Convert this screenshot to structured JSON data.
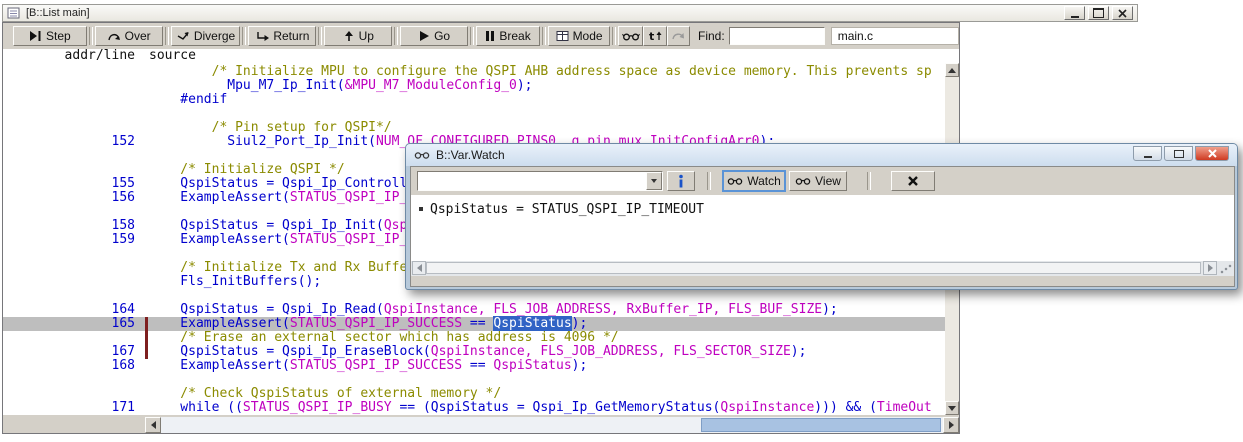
{
  "main_window": {
    "title": "[B::List main]",
    "toolbar": {
      "buttons": [
        {
          "id": "step",
          "label": "Step"
        },
        {
          "id": "over",
          "label": "Over"
        },
        {
          "id": "diverge",
          "label": "Diverge"
        },
        {
          "id": "return",
          "label": "Return"
        },
        {
          "id": "up",
          "label": "Up"
        },
        {
          "id": "go",
          "label": "Go"
        },
        {
          "id": "break",
          "label": "Break"
        },
        {
          "id": "mode",
          "label": "Mode"
        }
      ],
      "small_buttons": [
        {
          "id": "watch-glasses"
        },
        {
          "id": "t-up",
          "label": "t"
        },
        {
          "id": "redo-disabled"
        }
      ],
      "find_label": "Find:",
      "find_value": "",
      "file_field": "main.c"
    },
    "listing": {
      "header_addr": "addr/line",
      "header_source": "source",
      "rows": [
        {
          "num": "",
          "segments": [
            {
              "t": "        /* Initialize MPU to configure the QSPI AHB address space as device memory. This prevents sp",
              "c": "comment"
            }
          ]
        },
        {
          "num": "",
          "segments": [
            {
              "t": "          Mpu_M7_Ip_Init(",
              "c": "code"
            },
            {
              "t": "&MPU_M7_ModuleConfig_0",
              "c": "param"
            },
            {
              "t": ");",
              "c": "code"
            }
          ]
        },
        {
          "num": "",
          "segments": [
            {
              "t": "    #endif",
              "c": "code"
            }
          ]
        },
        {
          "num": "",
          "segments": []
        },
        {
          "num": "",
          "segments": [
            {
              "t": "        /* Pin setup for QSPI*/",
              "c": "comment"
            }
          ]
        },
        {
          "num": "152",
          "segments": [
            {
              "t": "          Siul2_Port_Ip_Init(",
              "c": "code"
            },
            {
              "t": "NUM_OF_CONFIGURED_PINS0, g_pin_mux_InitConfigArr0",
              "c": "param"
            },
            {
              "t": ");",
              "c": "code"
            }
          ]
        },
        {
          "num": "",
          "segments": []
        },
        {
          "num": "",
          "segments": [
            {
              "t": "    /* Initialize QSPI */",
              "c": "comment"
            }
          ]
        },
        {
          "num": "155",
          "segments": [
            {
              "t": "    QspiStatus = Qspi_Ip_ControllerInit(",
              "c": "code"
            }
          ]
        },
        {
          "num": "156",
          "segments": [
            {
              "t": "    ExampleAssert(",
              "c": "code"
            },
            {
              "t": "STATUS_QSPI_IP_SUCCESS ==",
              "c": "param"
            }
          ]
        },
        {
          "num": "",
          "segments": []
        },
        {
          "num": "158",
          "segments": [
            {
              "t": "    QspiStatus = Qspi_Ip_Init(",
              "c": "code"
            },
            {
              "t": "QspiInstance, &QspiConfig",
              "c": "param"
            }
          ]
        },
        {
          "num": "159",
          "segments": [
            {
              "t": "    ExampleAssert(",
              "c": "code"
            },
            {
              "t": "STATUS_QSPI_IP_SUCCESS ==",
              "c": "param"
            }
          ]
        },
        {
          "num": "",
          "segments": []
        },
        {
          "num": "",
          "segments": [
            {
              "t": "    /* Initialize Tx and Rx Buffers */",
              "c": "comment"
            }
          ]
        },
        {
          "num": "",
          "segments": [
            {
              "t": "    Fls_InitBuffers();",
              "c": "code"
            }
          ]
        },
        {
          "num": "",
          "segments": []
        },
        {
          "num": "164",
          "segments": [
            {
              "t": "    QspiStatus = Qspi_Ip_Read(",
              "c": "code"
            },
            {
              "t": "QspiInstance, FLS_JOB_ADDRESS, RxBuffer_IP, FLS_BUF_SIZE",
              "c": "param"
            },
            {
              "t": ");",
              "c": "code"
            }
          ]
        },
        {
          "num": "165",
          "hl": true,
          "segments": [
            {
              "t": "    ExampleAssert(",
              "c": "code"
            },
            {
              "t": "STATUS_QSPI_IP_SUCCESS",
              "c": "param"
            },
            {
              "t": " == ",
              "c": "code"
            },
            {
              "t": "QspiStatus",
              "c": "sel"
            },
            {
              "t": ");",
              "c": "code"
            }
          ]
        },
        {
          "num": "",
          "segments": [
            {
              "t": "    /* Erase an external sector which has address is 4096 */",
              "c": "comment"
            }
          ]
        },
        {
          "num": "167",
          "segments": [
            {
              "t": "    QspiStatus = Qspi_Ip_EraseBlock(",
              "c": "code"
            },
            {
              "t": "QspiInstance, FLS_JOB_ADDRESS, FLS_SECTOR_SIZE",
              "c": "param"
            },
            {
              "t": ");",
              "c": "code"
            }
          ]
        },
        {
          "num": "168",
          "segments": [
            {
              "t": "    ExampleAssert(",
              "c": "code"
            },
            {
              "t": "STATUS_QSPI_IP_SUCCESS",
              "c": "param"
            },
            {
              "t": " == ",
              "c": "code"
            },
            {
              "t": "QspiStatus",
              "c": "param"
            },
            {
              "t": ");",
              "c": "code"
            }
          ]
        },
        {
          "num": "",
          "segments": []
        },
        {
          "num": "",
          "segments": [
            {
              "t": "    /* Check QspiStatus of external memory */",
              "c": "comment"
            }
          ]
        },
        {
          "num": "171",
          "segments": [
            {
              "t": "    while ((",
              "c": "code"
            },
            {
              "t": "STATUS_QSPI_IP_BUSY",
              "c": "param"
            },
            {
              "t": " == (QspiStatus = Qspi_Ip_GetMemoryStatus(",
              "c": "code"
            },
            {
              "t": "QspiInstance",
              "c": "param"
            },
            {
              "t": "))) && (",
              "c": "code"
            },
            {
              "t": "TimeOut",
              "c": "param"
            }
          ]
        }
      ]
    }
  },
  "watch_window": {
    "title": "B::Var.Watch",
    "toolbar": {
      "combo_value": "",
      "watch_label": "Watch",
      "view_label": "View"
    },
    "entries": [
      {
        "text": "QspiStatus = STATUS_QSPI_IP_TIMEOUT"
      }
    ]
  },
  "icons": {
    "step": "triangle-with-bar",
    "over": "arc-arrow",
    "diverge": "branch-arrow",
    "return": "corner-arrow",
    "up": "up-arrow",
    "go": "play-triangle",
    "break": "pause-bars",
    "mode": "grid",
    "glasses": "eyeglasses",
    "info": "blue-i",
    "delete": "bold-x"
  },
  "colors": {
    "comment": "#8b8b00",
    "code": "#0000cd",
    "param": "#bf00bf",
    "linenum": "#0000cd",
    "hlrow": "#bebebe",
    "selbg": "#3163c5",
    "selfg": "#ffffff",
    "bpbar": "#7e1f1f"
  }
}
